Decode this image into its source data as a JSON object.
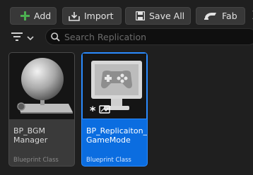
{
  "toolbar": {
    "add_label": "Add",
    "import_label": "Import",
    "save_all_label": "Save All",
    "fab_label": "Fab"
  },
  "search": {
    "placeholder": "Search Replication"
  },
  "assets": [
    {
      "name": "BP_BGM\nManager",
      "class": "Blueprint Class",
      "selected": false
    },
    {
      "name": "BP_Replicaiton_\nGameMode",
      "class": "Blueprint Class",
      "selected": true
    }
  ],
  "colors": {
    "accent": "#0b6de0",
    "add_icon": "#4caf50",
    "background": "#1f1f1f"
  }
}
